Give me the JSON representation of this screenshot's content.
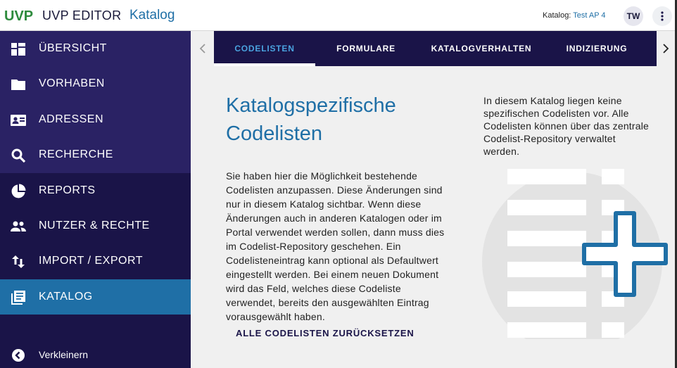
{
  "header": {
    "logo_text": "UVP",
    "app_title": "UVP EDITOR",
    "page_name": "Katalog",
    "catalog_label": "Katalog:",
    "catalog_value": "Test AP 4",
    "user_initials": "TW"
  },
  "sidebar": {
    "items": [
      {
        "label": "ÜBERSICHT",
        "icon": "dashboard-icon"
      },
      {
        "label": "VORHABEN",
        "icon": "folder-icon"
      },
      {
        "label": "ADRESSEN",
        "icon": "contact-card-icon"
      },
      {
        "label": "RECHERCHE",
        "icon": "search-icon"
      },
      {
        "label": "REPORTS",
        "icon": "pie-chart-icon"
      },
      {
        "label": "NUTZER & RECHTE",
        "icon": "people-icon"
      },
      {
        "label": "IMPORT / EXPORT",
        "icon": "import-export-icon"
      },
      {
        "label": "KATALOG",
        "icon": "library-books-icon"
      }
    ],
    "active": "KATALOG",
    "collapse_label": "Verkleinern"
  },
  "tabs": [
    {
      "label": "CODELISTEN"
    },
    {
      "label": "FORMULARE"
    },
    {
      "label": "KATALOGVERHALTEN"
    },
    {
      "label": "INDIZIERUNG"
    }
  ],
  "main": {
    "heading": "Katalogspezifische Codelisten",
    "body": "Sie haben hier die Möglichkeit bestehende Codelisten anzupassen. Diese Änderungen sind nur in diesem Katalog sichtbar. Wenn diese Änderungen auch in anderen Katalogen oder im Portal verwendet werden sollen, dann muss dies im Codelist-Repository geschehen. Ein Codelisteneintrag kann optional als Defaultwert eingestellt werden. Bei einem neuen Dokument wird das Feld, welches diese Codeliste verwendet, bereits den ausgewählten Eintrag vorausgewählt haben.",
    "reset_button": "ALLE CODELISTEN ZURÜCKSETZEN",
    "info": "In diesem Katalog liegen keine spezifischen Codelisten vor. Alle Codelisten können über das zentrale Codelist-Repository verwaltet werden."
  },
  "colors": {
    "sidebar_bg": "#1a1448",
    "sidebar_top_bg": "#2a2264",
    "active_blue": "#1f6fa6",
    "tab_active": "#4aa3df",
    "content_bg": "#f0f0f0"
  }
}
